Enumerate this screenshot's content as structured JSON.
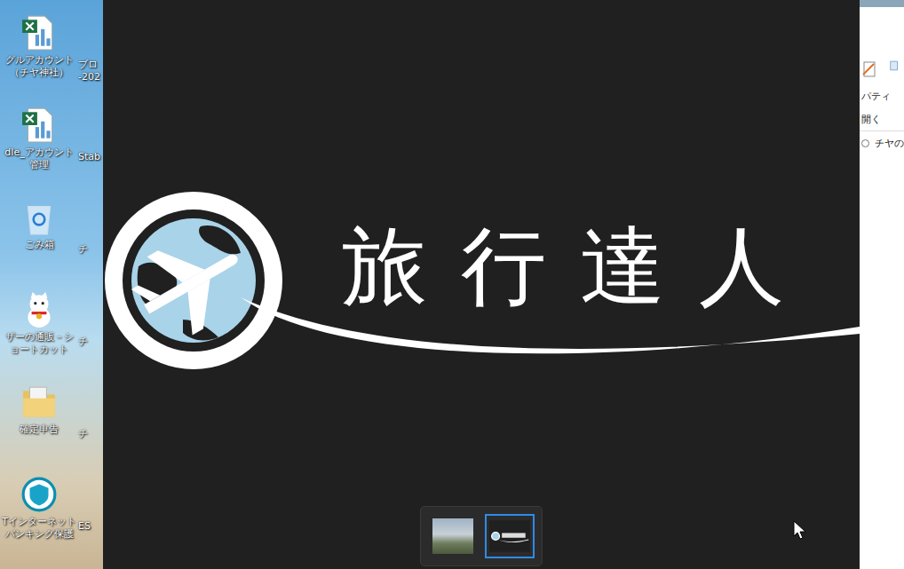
{
  "desktop": {
    "icons": [
      {
        "kind": "excel",
        "label": "グルアカウント（チヤ神社）",
        "peek": "ブロ -202"
      },
      {
        "kind": "excel",
        "label": "dle_アカウント管理",
        "peek": "Stab"
      },
      {
        "kind": "recycle",
        "label": "ごみ箱",
        "peek": "チ"
      },
      {
        "kind": "cat",
        "label": "ザーの通販－ショートカット",
        "peek": "チ"
      },
      {
        "kind": "folder",
        "label": "確定申告",
        "peek": "チ"
      },
      {
        "kind": "app",
        "label": "Tインターネットバンキング保護",
        "peek": "ES"
      }
    ]
  },
  "viewer": {
    "logo_text": "旅行達人",
    "thumbnails": [
      {
        "kind": "photo",
        "selected": false
      },
      {
        "kind": "logo",
        "selected": true
      }
    ]
  },
  "explorer": {
    "ribbon": [
      "パティ",
      "開く"
    ],
    "address": "チヤの"
  }
}
